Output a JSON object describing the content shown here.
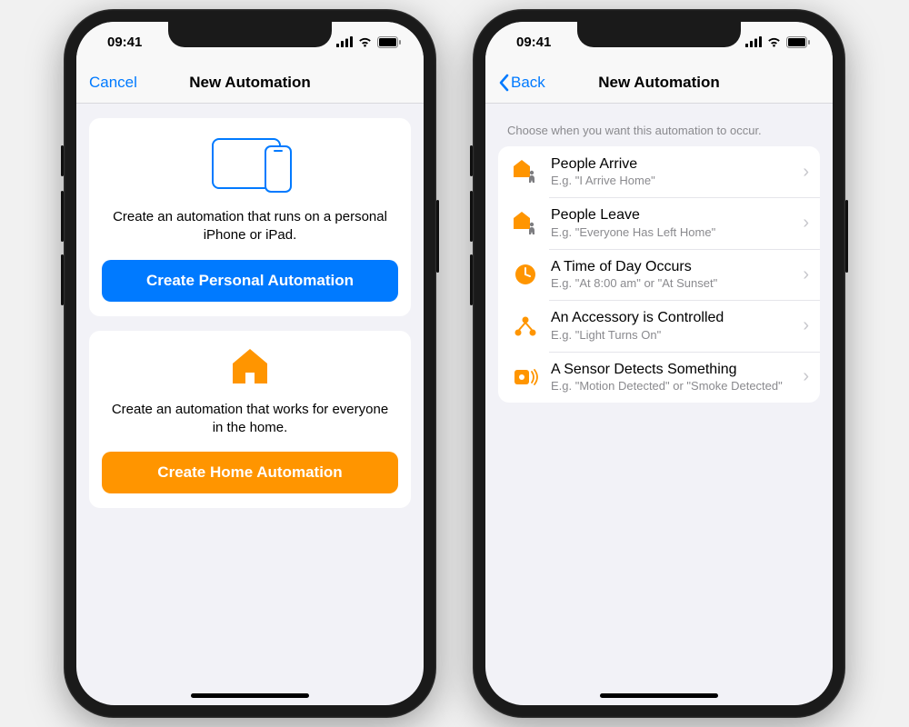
{
  "status": {
    "time": "09:41"
  },
  "colors": {
    "accent_blue": "#007aff",
    "accent_orange": "#ff9500"
  },
  "phoneA": {
    "nav": {
      "left": "Cancel",
      "title": "New Automation"
    },
    "personal": {
      "desc": "Create an automation that runs on a personal iPhone or iPad.",
      "cta": "Create Personal Automation"
    },
    "home": {
      "desc": "Create an automation that works for everyone in the home.",
      "cta": "Create Home Automation"
    }
  },
  "phoneB": {
    "nav": {
      "back": "Back",
      "title": "New Automation"
    },
    "section_header": "Choose when you want this automation to occur.",
    "triggers": [
      {
        "icon": "people-arrive-icon",
        "title": "People Arrive",
        "sub": "E.g. \"I Arrive Home\""
      },
      {
        "icon": "people-leave-icon",
        "title": "People Leave",
        "sub": "E.g. \"Everyone Has Left Home\""
      },
      {
        "icon": "clock-icon",
        "title": "A Time of Day Occurs",
        "sub": "E.g. \"At 8:00 am\" or \"At Sunset\""
      },
      {
        "icon": "accessory-icon",
        "title": "An Accessory is Controlled",
        "sub": "E.g. \"Light Turns On\""
      },
      {
        "icon": "sensor-icon",
        "title": "A Sensor Detects Something",
        "sub": "E.g. \"Motion Detected\" or \"Smoke Detected\""
      }
    ]
  }
}
